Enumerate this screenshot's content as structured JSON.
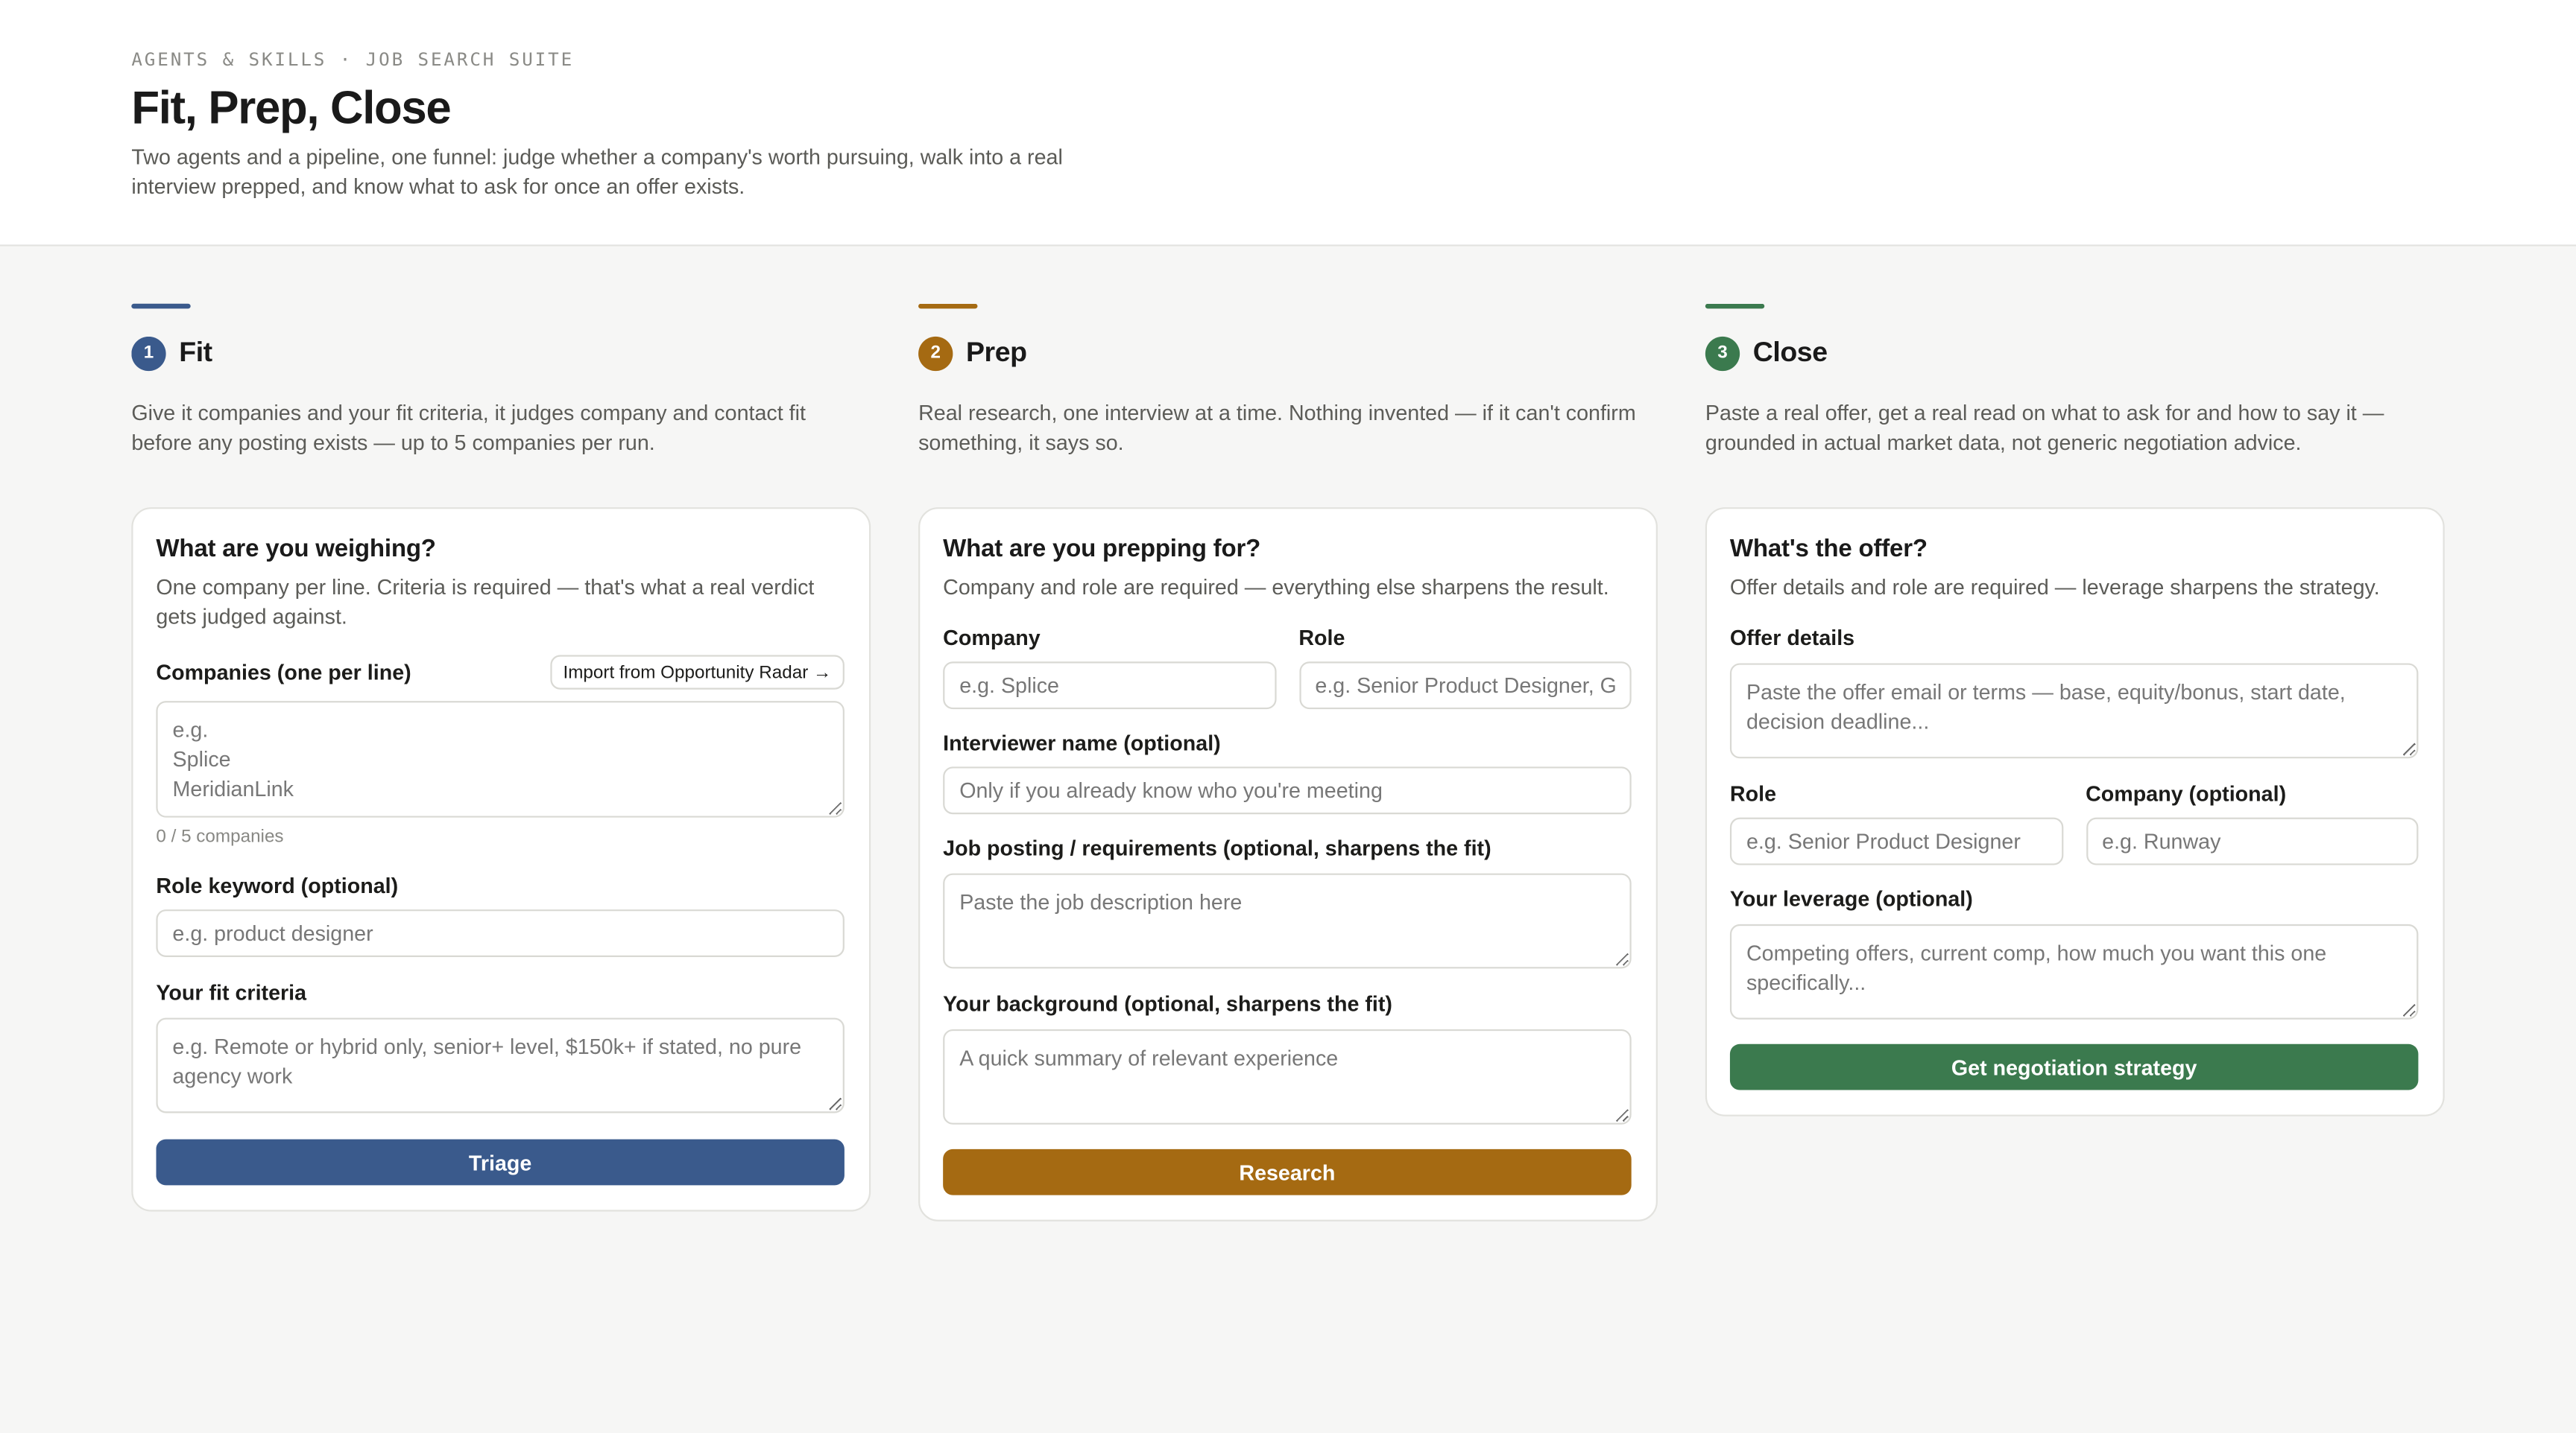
{
  "header": {
    "eyebrow": "AGENTS & SKILLS · JOB SEARCH SUITE",
    "title": "Fit, Prep, Close",
    "subtitle": "Two agents and a pipeline, one funnel: judge whether a company's worth pursuing, walk into a real interview prepped, and know what to ask for once an offer exists."
  },
  "colors": {
    "fit": "#3a5a8c",
    "prep": "#a56a12",
    "close": "#3b7a4e"
  },
  "fit": {
    "number": "1",
    "title": "Fit",
    "description": "Give it companies and your fit criteria, it judges company and contact fit before any posting exists — up to 5 companies per run.",
    "card_title": "What are you weighing?",
    "card_sub": "One company per line. Criteria is required — that's what a real verdict gets judged against.",
    "companies_label": "Companies (one per line)",
    "import_label": "Import from Opportunity Radar →",
    "companies_placeholder": "e.g.\nSplice\nMeridianLink",
    "counter": "0 / 5 companies",
    "role_label": "Role keyword (optional)",
    "role_placeholder": "e.g. product designer",
    "criteria_label": "Your fit criteria",
    "criteria_placeholder": "e.g. Remote or hybrid only, senior+ level, $150k+ if stated, no pure agency work",
    "button": "Triage"
  },
  "prep": {
    "number": "2",
    "title": "Prep",
    "description": "Real research, one interview at a time. Nothing invented — if it can't confirm something, it says so.",
    "card_title": "What are you prepping for?",
    "card_sub": "Company and role are required — everything else sharpens the result.",
    "company_label": "Company",
    "company_placeholder": "e.g. Splice",
    "role_label": "Role",
    "role_placeholder": "e.g. Senior Product Designer, Growth",
    "interviewer_label": "Interviewer name (optional)",
    "interviewer_placeholder": "Only if you already know who you're meeting",
    "posting_label": "Job posting / requirements (optional, sharpens the fit)",
    "posting_placeholder": "Paste the job description here",
    "background_label": "Your background (optional, sharpens the fit)",
    "background_placeholder": "A quick summary of relevant experience",
    "button": "Research"
  },
  "close": {
    "number": "3",
    "title": "Close",
    "description": "Paste a real offer, get a real read on what to ask for and how to say it — grounded in actual market data, not generic negotiation advice.",
    "card_title": "What's the offer?",
    "card_sub": "Offer details and role are required — leverage sharpens the strategy.",
    "offer_label": "Offer details",
    "offer_placeholder": "Paste the offer email or terms — base, equity/bonus, start date, decision deadline...",
    "role_label": "Role",
    "role_placeholder": "e.g. Senior Product Designer",
    "company_label": "Company (optional)",
    "company_placeholder": "e.g. Runway",
    "leverage_label": "Your leverage (optional)",
    "leverage_placeholder": "Competing offers, current comp, how much you want this one specifically...",
    "button": "Get negotiation strategy"
  }
}
